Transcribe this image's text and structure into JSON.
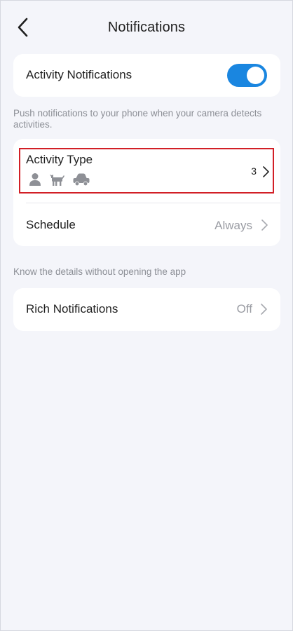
{
  "header": {
    "title": "Notifications"
  },
  "activity_notifications": {
    "label": "Activity Notifications",
    "enabled": true,
    "description": "Push notifications to your phone when your camera detects activities."
  },
  "activity_type": {
    "label": "Activity Type",
    "count": "3",
    "icons": [
      "person-icon",
      "dog-icon",
      "car-icon"
    ]
  },
  "schedule": {
    "label": "Schedule",
    "value": "Always"
  },
  "rich_section": {
    "description": "Know the details without opening the app"
  },
  "rich_notifications": {
    "label": "Rich Notifications",
    "value": "Off"
  },
  "colors": {
    "accent": "#1a86e0",
    "background": "#f4f5fa",
    "highlight": "#d21f26"
  }
}
